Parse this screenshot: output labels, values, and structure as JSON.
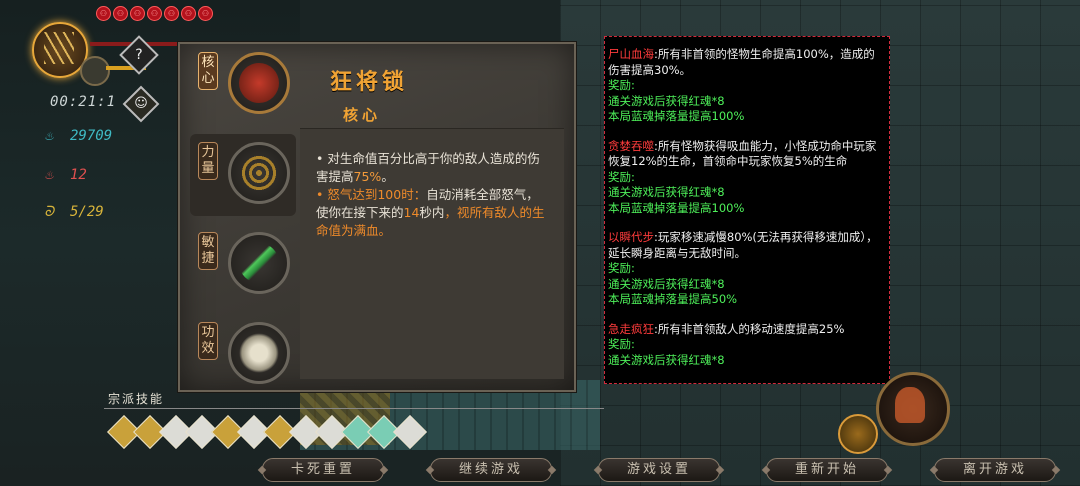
{
  "hud": {
    "hearts": [
      "⚇",
      "⚇",
      "⚇",
      "⚇",
      "⚇",
      "⚇",
      "⚇"
    ],
    "help_symbol": "?",
    "timer": "00:21:1",
    "stats": [
      {
        "icon": "blue-flame-icon",
        "value": "29709",
        "color": "#3fbac4"
      },
      {
        "icon": "red-flame-icon",
        "value": "12",
        "color": "#e0504f"
      },
      {
        "icon": "gold-spirit-icon",
        "value": "5/29",
        "color": "#d8b43a"
      }
    ]
  },
  "panel": {
    "tabs": [
      {
        "label": "核心",
        "icon": "skull-mask-icon"
      },
      {
        "label": "力量",
        "icon": "chain-icon"
      },
      {
        "label": "敏捷",
        "icon": "green-blade-icon"
      },
      {
        "label": "功效",
        "icon": "bone-scroll-icon"
      }
    ],
    "title": "狂将锁",
    "subtitle": "核心",
    "desc": {
      "bullet1_a": "• 对生命值百分比高于你的敌人造成的伤害提高",
      "bullet1_pct": "75%",
      "bullet1_end": "。",
      "bullet2_dot": "• ",
      "bullet2_cond": "怒气达到100时：",
      "bullet2_a": "自动消耗全部怒气，使你在接下来的",
      "bullet2_secs": "14",
      "bullet2_b": "秒内",
      "bullet2_c": "，视所有敌人的生命值为满血。"
    }
  },
  "info": {
    "blocks": [
      {
        "name": "尸山血海",
        "text": ":所有非首领的怪物生命提高100%，造成的伤害提高30%。",
        "reward_label": "奖励:",
        "rewards": [
          "通关游戏后获得红魂*8",
          "本局蓝魂掉落量提高100%"
        ]
      },
      {
        "name": "贪婪吞噬",
        "text": ":所有怪物获得吸血能力，小怪成功命中玩家恢复12%的生命，首领命中玩家恢复5%的生命",
        "reward_label": "奖励:",
        "rewards": [
          "通关游戏后获得红魂*8",
          "本局蓝魂掉落量提高100%"
        ]
      },
      {
        "name": "以瞬代步",
        "text": ":玩家移速减慢80%(无法再获得移速加成），延长瞬身距离与无敌时间。",
        "reward_label": "奖励:",
        "rewards": [
          "通关游戏后获得红魂*8",
          "本局蓝魂掉落量提高50%"
        ]
      },
      {
        "name": "急走疯狂",
        "text": ":所有非首领敌人的移动速度提高25%",
        "reward_label": "奖励:",
        "rewards": [
          "通关游戏后获得红魂*8"
        ]
      }
    ]
  },
  "skills": {
    "label": "宗派技能",
    "count": 12
  },
  "buttons": [
    "卡死重置",
    "继续游戏",
    "游戏设置",
    "重新开始",
    "离开游戏"
  ]
}
